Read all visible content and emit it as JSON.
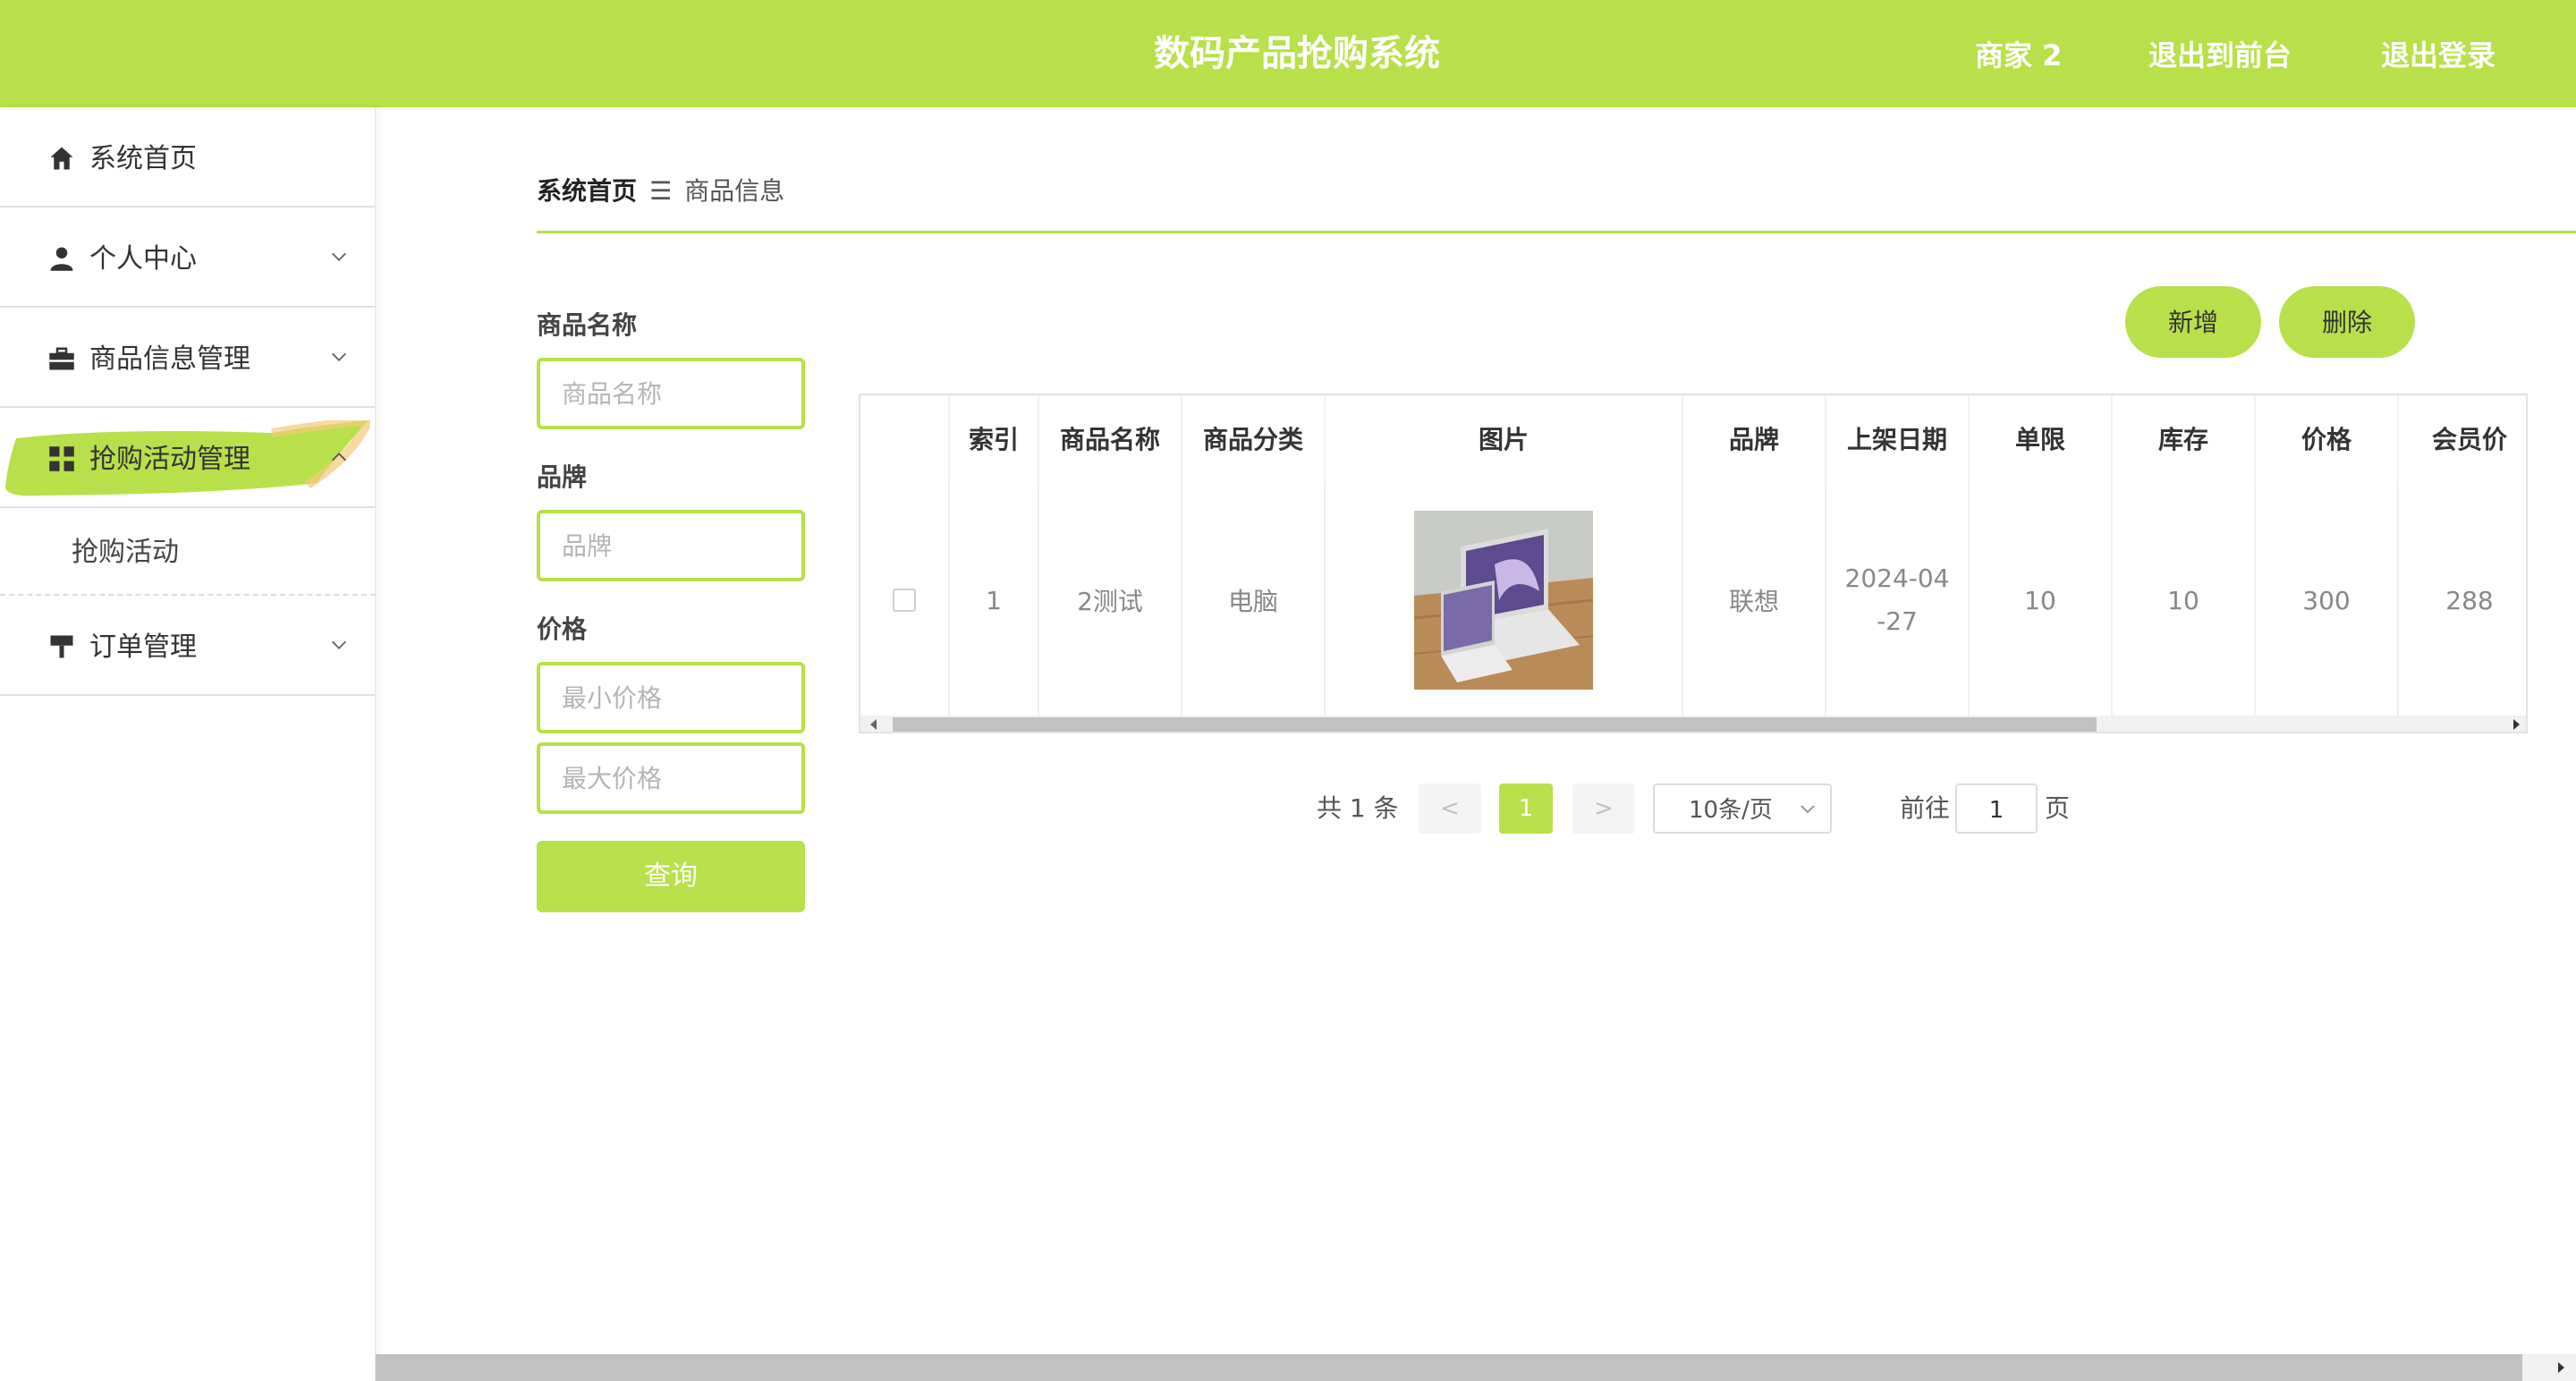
{
  "header": {
    "title": "数码产品抢购系统",
    "user": "商家 2",
    "front_link": "退出到前台",
    "logout_link": "退出登录",
    "bg_color": "#b8e04a"
  },
  "sidebar": {
    "items": [
      {
        "label": "系统首页",
        "icon": "home-icon"
      },
      {
        "label": "个人中心",
        "icon": "user-icon"
      },
      {
        "label": "商品信息管理",
        "icon": "briefcase-icon"
      },
      {
        "label": "抢购活动管理",
        "icon": "grid-icon",
        "active": true
      },
      {
        "label": "抢购活动",
        "sub": true
      },
      {
        "label": "订单管理",
        "icon": "stamp-icon"
      }
    ]
  },
  "breadcrumb": {
    "home": "系统首页",
    "separator": "☰",
    "current": "商品信息"
  },
  "filters": {
    "name_label": "商品名称",
    "name_placeholder": "商品名称",
    "brand_label": "品牌",
    "brand_placeholder": "品牌",
    "price_label": "价格",
    "min_placeholder": "最小价格",
    "max_placeholder": "最大价格",
    "query_label": "查询"
  },
  "actions": {
    "add_label": "新增",
    "delete_label": "删除"
  },
  "table": {
    "columns": [
      "索引",
      "商品名称",
      "商品分类",
      "图片",
      "品牌",
      "上架日期",
      "单限",
      "库存",
      "价格",
      "会员价"
    ],
    "rows": [
      {
        "index": "1",
        "name": "2测试",
        "category": "电脑",
        "brand": "联想",
        "date_line1": "2024-04",
        "date_line2": "-27",
        "limit": "10",
        "stock": "10",
        "price": "300",
        "member_price": "288"
      }
    ]
  },
  "pagination": {
    "total": "共 1 条",
    "prev": "<",
    "current_page": "1",
    "next": ">",
    "page_size": "10条/页",
    "goto_label": "前往",
    "goto_value": "1",
    "page_unit": "页"
  }
}
